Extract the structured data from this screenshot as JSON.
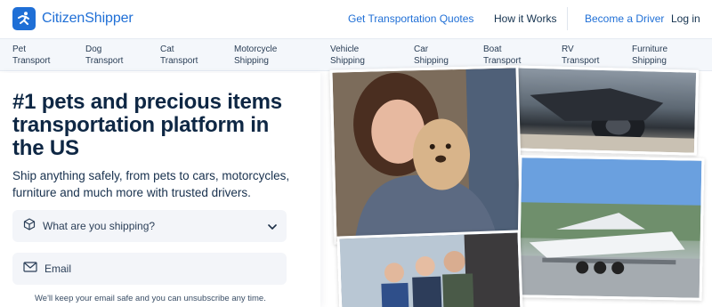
{
  "header": {
    "logo_text": "CitizenShipper",
    "nav": {
      "quotes": "Get Transportation Quotes",
      "how": "How it Works",
      "driver": "Become a Driver",
      "login": "Log in"
    }
  },
  "categories": [
    {
      "line1": "Pet",
      "line2": "Transport"
    },
    {
      "line1": "Dog",
      "line2": "Transport"
    },
    {
      "line1": "Cat",
      "line2": "Transport"
    },
    {
      "line1": "Motorcycle",
      "line2": "Shipping"
    },
    {
      "line1": "Vehicle",
      "line2": "Shipping"
    },
    {
      "line1": "Car",
      "line2": "Shipping"
    },
    {
      "line1": "Boat",
      "line2": "Transport"
    },
    {
      "line1": "RV",
      "line2": "Transport"
    },
    {
      "line1": "Furniture",
      "line2": "Shipping"
    }
  ],
  "hero": {
    "title": "#1 pets and precious items transportation platform in the US",
    "subtitle": "Ship anything safely, from pets to cars, motorcycles, furniture and much more with trusted drivers.",
    "shipping_field_placeholder": "What are you shipping?",
    "email_field_label": "Email",
    "privacy_note": "We'll keep your email safe and you can unsubscribe any time."
  },
  "colors": {
    "brand": "#1f6fd6",
    "heading": "#0e2744",
    "field_bg": "#f3f5f9"
  },
  "icons": {
    "logo": "runner-logo-icon",
    "shipping_field": "box-icon",
    "dropdown": "chevron-down-icon",
    "email_field": "envelope-icon"
  }
}
